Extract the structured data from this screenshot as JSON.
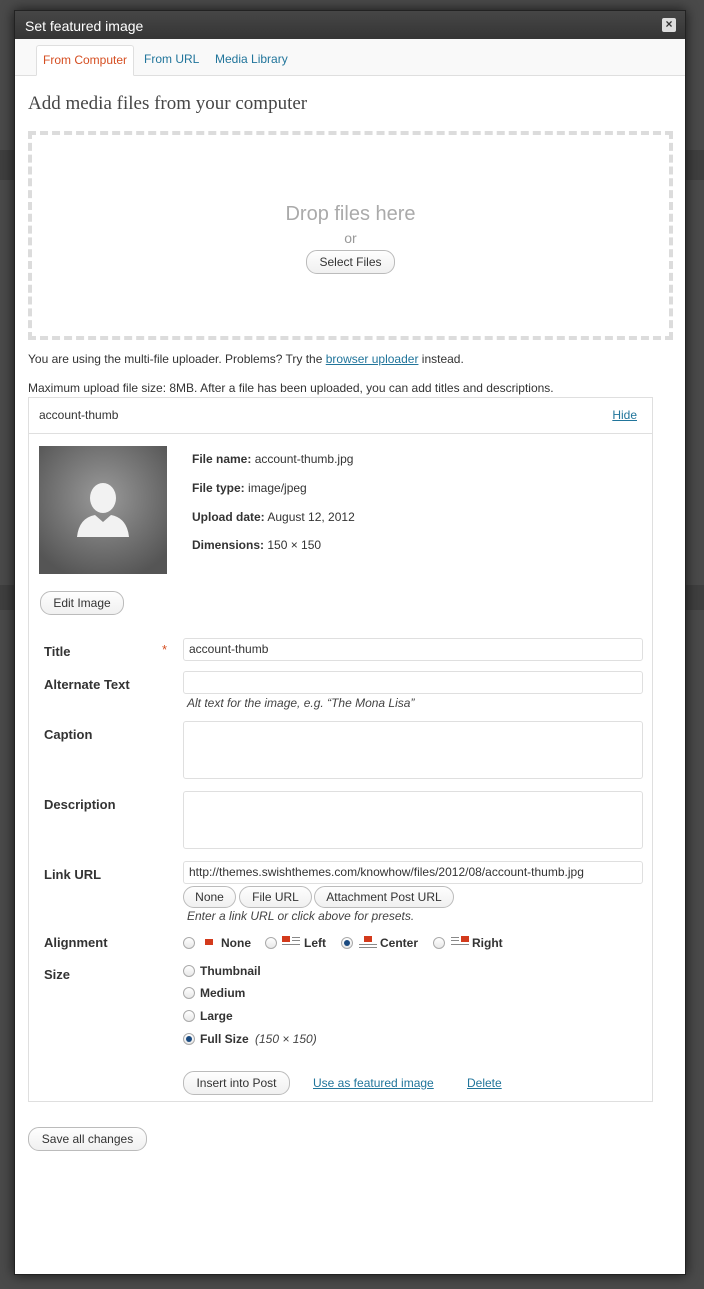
{
  "dialog": {
    "title": "Set featured image",
    "close_glyph": "×"
  },
  "tabs": [
    {
      "label": "From Computer",
      "active": true
    },
    {
      "label": "From URL",
      "active": false
    },
    {
      "label": "Media Library",
      "active": false
    }
  ],
  "upload": {
    "heading": "Add media files from your computer",
    "drop_text": "Drop files here",
    "or_text": "or",
    "select_button": "Select Files",
    "multi_prefix": "You are using the multi-file uploader. Problems? Try the ",
    "browser_link": "browser uploader",
    "multi_suffix": " instead.",
    "max_size_line": "Maximum upload file size: 8MB. After a file has been uploaded, you can add titles and descriptions."
  },
  "item": {
    "name": "account-thumb",
    "hide_link": "Hide",
    "thumbnail_icon": "user-silhouette-icon",
    "meta": [
      {
        "label": "File name:",
        "value": " account-thumb.jpg"
      },
      {
        "label": "File type:",
        "value": " image/jpeg"
      },
      {
        "label": "Upload date:",
        "value": " August 12, 2012"
      },
      {
        "label": "Dimensions:",
        "value": " 150 × 150"
      }
    ],
    "edit_image_button": "Edit Image"
  },
  "form": {
    "title_label": "Title",
    "required_mark": "*",
    "title_value": "account-thumb",
    "alt_label": "Alternate Text",
    "alt_value": "",
    "alt_help": "Alt text for the image, e.g. “The Mona Lisa”",
    "caption_label": "Caption",
    "caption_value": "",
    "description_label": "Description",
    "description_value": "",
    "link_label": "Link URL",
    "link_value": "http://themes.swishthemes.com/knowhow/files/2012/08/account-thumb.jpg",
    "link_buttons": [
      "None",
      "File URL",
      "Attachment Post URL"
    ],
    "link_help": "Enter a link URL or click above for presets.",
    "alignment_label": "Alignment",
    "alignment_options": [
      {
        "label": "None",
        "checked": false
      },
      {
        "label": "Left",
        "checked": false
      },
      {
        "label": "Center",
        "checked": true
      },
      {
        "label": "Right",
        "checked": false
      }
    ],
    "size_label": "Size",
    "size_options": [
      {
        "label": "Thumbnail",
        "checked": false
      },
      {
        "label": "Medium",
        "checked": false
      },
      {
        "label": "Large",
        "checked": false
      },
      {
        "label": "Full Size",
        "checked": true,
        "note": "(150 × 150)"
      }
    ],
    "insert_button": "Insert into Post",
    "featured_link": "Use as featured image",
    "delete_link": "Delete"
  },
  "footer": {
    "save_button": "Save all changes"
  },
  "colors": {
    "accent_active_tab": "#d54e21",
    "link": "#21759b",
    "titlebar": "#404040"
  }
}
